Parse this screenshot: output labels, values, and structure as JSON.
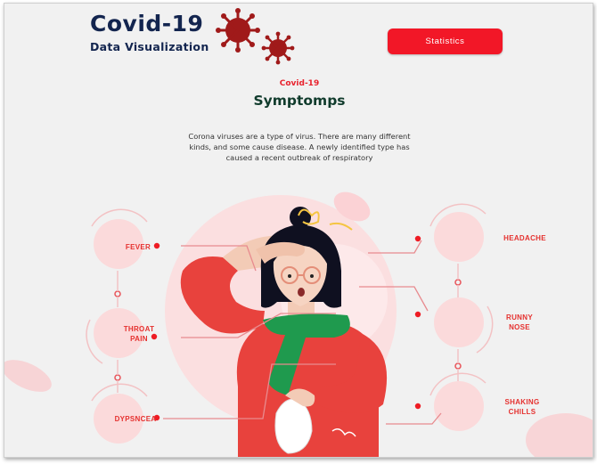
{
  "header": {
    "title": "Covid-19",
    "subtitle": "Data Visualization",
    "logo_icon": "virus-icon"
  },
  "nav": {
    "statistics_label": "Statistics"
  },
  "intro": {
    "kicker": "Covid-19",
    "heading": "Symptomps",
    "description": "Corona viruses are a type of virus. There are many different kinds, and some cause disease. A newly identified type has caused a recent outbreak of respiratory"
  },
  "symptoms": {
    "left": [
      {
        "label": "FEVER"
      },
      {
        "label": "THROAT\nPAIN"
      },
      {
        "label": "DYPSNCEA"
      }
    ],
    "right": [
      {
        "label": "HEADACHE"
      },
      {
        "label": "RUNNY\nNOSE"
      },
      {
        "label": "SHAKING\nCHILLS"
      }
    ]
  },
  "colors": {
    "accent": "#f21727",
    "navy": "#13254f",
    "green_heading": "#103b2c",
    "virus": "#a01a1a",
    "symptom_text": "#e5312f"
  }
}
